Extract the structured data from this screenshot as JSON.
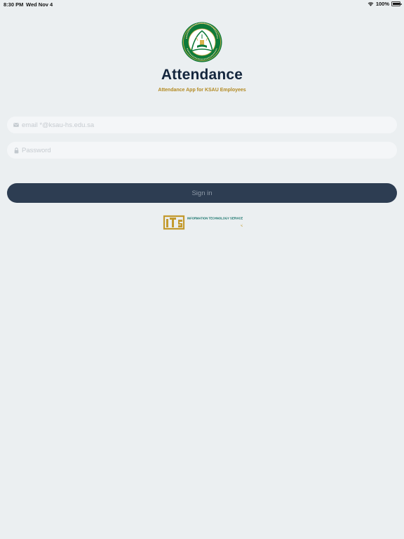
{
  "status_bar": {
    "time": "8:30 PM",
    "date": "Wed Nov 4",
    "battery": "100%",
    "battery_level": 1.0,
    "wifi_icon": "wifi-icon"
  },
  "app": {
    "title": "Attendance",
    "subtitle": "Attendance App for KSAU Employees"
  },
  "login": {
    "email_placeholder": "email *@ksau-hs.edu.sa",
    "email_value": "",
    "password_placeholder": "Password",
    "password_value": "",
    "sign_in_label": "Sign in"
  },
  "footer": {
    "its_logo_text_en": "INFORMATION TECHNOLOGY SERVICES",
    "its_logo_text_ar": "خدمات تقنية المعلومات"
  },
  "colors": {
    "background": "#ebeff1",
    "title": "#14263d",
    "accent_gold": "#b38a22",
    "button": "#2d3d52",
    "logo_green": "#0e7a3a"
  }
}
